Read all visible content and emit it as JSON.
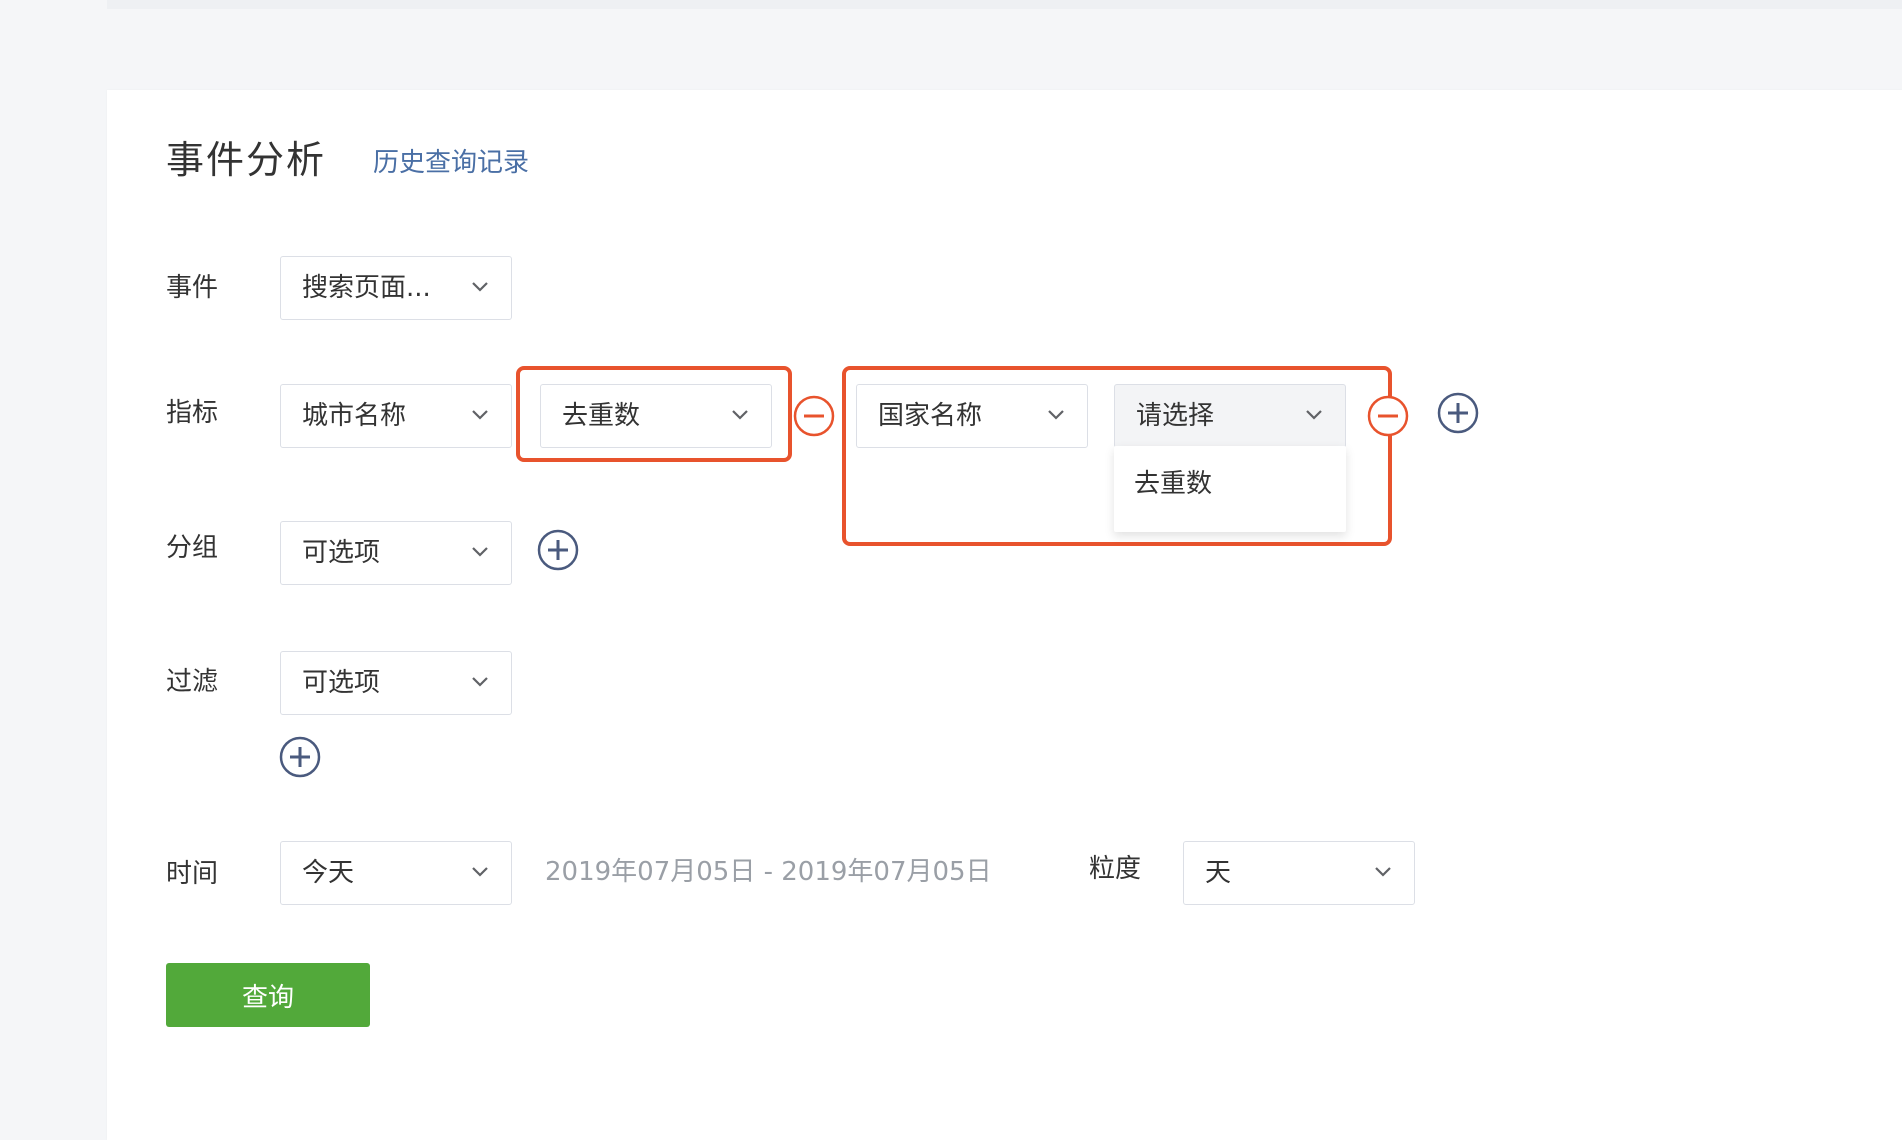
{
  "header": {
    "title": "事件分析",
    "history_link": "历史查询记录"
  },
  "rows": {
    "event": {
      "label": "事件",
      "select": "搜索页面..."
    },
    "metric": {
      "label": "指标",
      "select1": "城市名称",
      "select2": "去重数",
      "select3": "国家名称",
      "select4": "请选择"
    },
    "group": {
      "label": "分组",
      "select": "可选项"
    },
    "filter": {
      "label": "过滤",
      "select": "可选项"
    },
    "time": {
      "label": "时间",
      "select": "今天",
      "date_range": "2019年07月05日 - 2019年07月05日",
      "granularity_label": "粒度",
      "granularity_select": "天"
    }
  },
  "dropdown": {
    "options": [
      "去重数"
    ]
  },
  "actions": {
    "query": "查询"
  },
  "colors": {
    "accent_green": "#52a93a",
    "remove_red": "#e8532d",
    "add_blue": "#4a5a7e",
    "link_blue": "#4a6fa5"
  },
  "icons": {
    "chevron": "chevron-down-icon",
    "remove": "minus-circle-icon",
    "add": "plus-circle-icon"
  }
}
